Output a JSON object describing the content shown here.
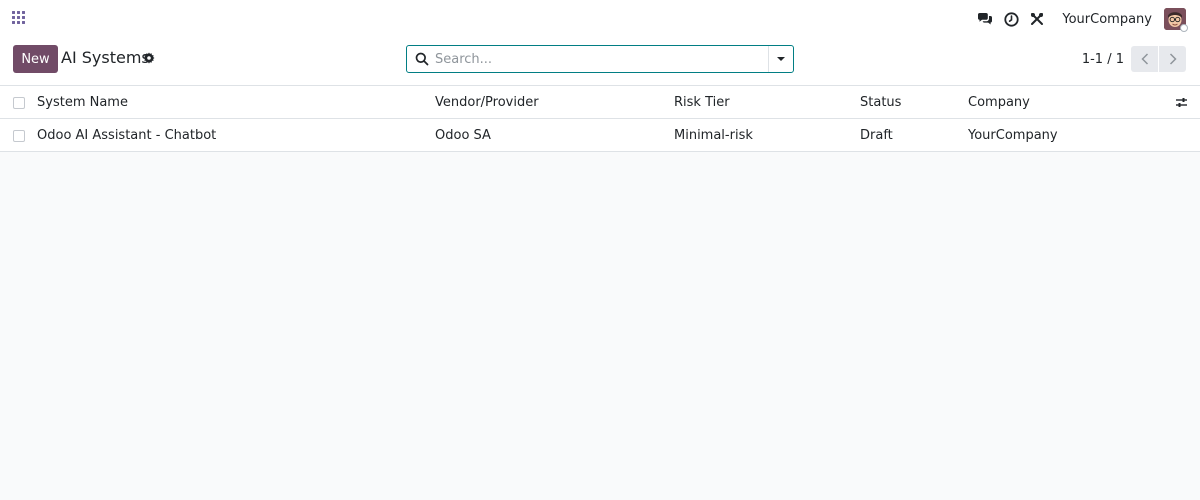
{
  "navbar": {
    "company_name": "YourCompany",
    "icons": [
      "apps-menu-icon",
      "discuss-chat-icon",
      "activity-clock-icon",
      "debug-tools-icon",
      "user-avatar"
    ]
  },
  "control_panel": {
    "new_button_label": "New",
    "title": "AI Systems",
    "search_placeholder": "Search...",
    "pager_value": "1-1 / 1"
  },
  "table": {
    "columns": [
      "System Name",
      "Vendor/Provider",
      "Risk Tier",
      "Status",
      "Company"
    ],
    "rows": [
      {
        "system_name": "Odoo AI Assistant - Chatbot",
        "vendor": "Odoo SA",
        "risk_tier": "Minimal-risk",
        "status": "Draft",
        "company": "YourCompany"
      }
    ]
  },
  "colors": {
    "brand": "#714b67",
    "search_border": "#017e84",
    "apps_icon": "#71639e"
  }
}
